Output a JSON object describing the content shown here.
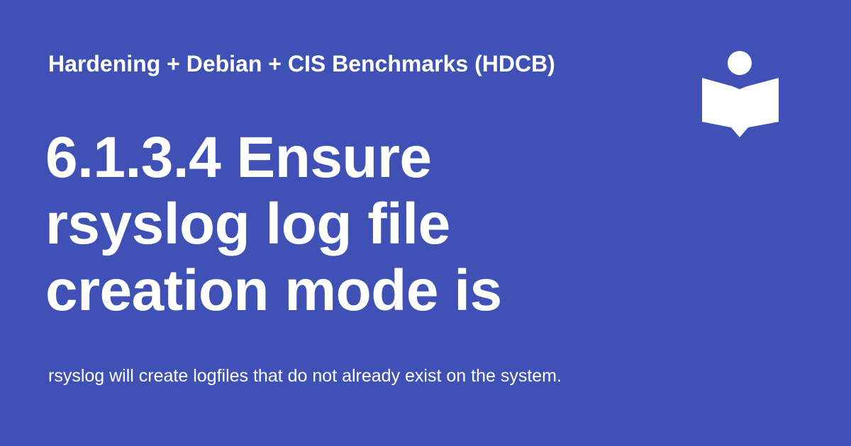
{
  "header": {
    "site_title": "Hardening + Debian + CIS Benchmarks (HDCB)",
    "logo_icon": "reader-book-icon"
  },
  "main": {
    "title": "6.1.3.4 Ensure rsyslog log file creation mode is",
    "description": "rsyslog will create logfiles that do not already exist on the system."
  },
  "colors": {
    "background": "#3f51b5",
    "text": "#ffffff"
  }
}
